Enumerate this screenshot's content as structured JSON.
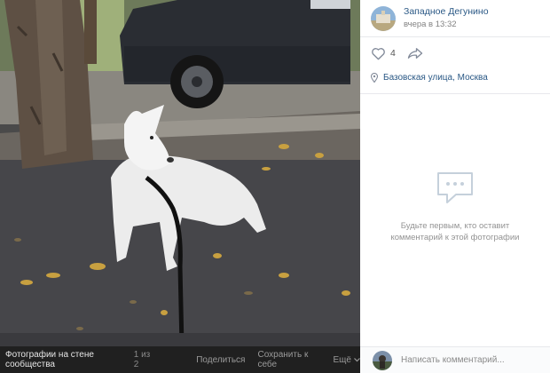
{
  "photo": {
    "alt": "white dog lying on the pavement on a leash next to a parked car"
  },
  "photo_bar": {
    "album_label": "Фотографии на стене сообщества",
    "counter": "1 из 2",
    "share_label": "Поделиться",
    "save_label": "Сохранить к себе",
    "more_label": "Ещё"
  },
  "post": {
    "author": "Западное Дегунино",
    "time": "вчера в 13:32",
    "likes": "4",
    "location": "Базовская улица, Москва"
  },
  "comments": {
    "empty_text": "Будьте первым, кто оставит комментарий к этой фотографии",
    "placeholder": "Написать комментарий..."
  },
  "colors": {
    "link": "#2a5885",
    "bar_bg": "#202020"
  },
  "icons": [
    "heart-icon",
    "share-arrow-icon",
    "location-pin-icon",
    "comments-empty-icon",
    "chevron-down-icon"
  ]
}
